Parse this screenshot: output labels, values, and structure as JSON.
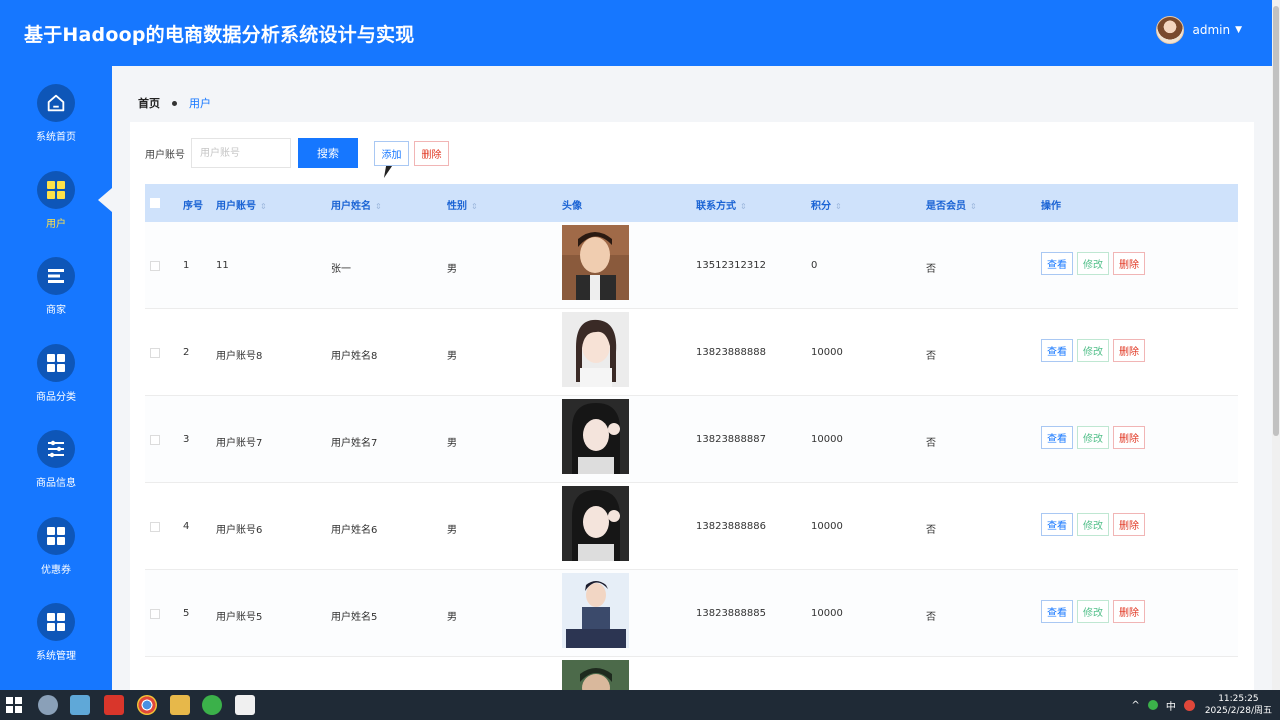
{
  "header": {
    "title": "基于Hadoop的电商数据分析系统设计与实现",
    "username": "admin"
  },
  "sidebar": {
    "items": [
      {
        "label": "系统首页",
        "icon": "home-icon"
      },
      {
        "label": "用户",
        "icon": "grid-icon",
        "active": true
      },
      {
        "label": "商家",
        "icon": "list-icon"
      },
      {
        "label": "商品分类",
        "icon": "grid-icon"
      },
      {
        "label": "商品信息",
        "icon": "sliders-icon"
      },
      {
        "label": "优惠券",
        "icon": "grid-icon"
      },
      {
        "label": "系统管理",
        "icon": "grid-icon"
      }
    ]
  },
  "breadcrumb": {
    "home": "首页",
    "current": "用户"
  },
  "search": {
    "label": "用户账号",
    "placeholder": "用户账号",
    "value": "",
    "button": "搜索",
    "add": "添加",
    "delete": "删除"
  },
  "table": {
    "headers": [
      "序号",
      "用户账号",
      "用户姓名",
      "性别",
      "头像",
      "联系方式",
      "积分",
      "是否会员",
      "操作"
    ],
    "actions": {
      "view": "查看",
      "edit": "修改",
      "delete": "删除"
    },
    "rows": [
      {
        "no": "1",
        "account": "11",
        "name": "张一",
        "gender": "男",
        "phone": "13512312312",
        "points": "0",
        "member": "否"
      },
      {
        "no": "2",
        "account": "用户账号8",
        "name": "用户姓名8",
        "gender": "男",
        "phone": "13823888888",
        "points": "10000",
        "member": "否"
      },
      {
        "no": "3",
        "account": "用户账号7",
        "name": "用户姓名7",
        "gender": "男",
        "phone": "13823888887",
        "points": "10000",
        "member": "否"
      },
      {
        "no": "4",
        "account": "用户账号6",
        "name": "用户姓名6",
        "gender": "男",
        "phone": "13823888886",
        "points": "10000",
        "member": "否"
      },
      {
        "no": "5",
        "account": "用户账号5",
        "name": "用户姓名5",
        "gender": "男",
        "phone": "13823888885",
        "points": "10000",
        "member": "否"
      }
    ]
  },
  "taskbar": {
    "ime": "中",
    "time": "11:25:25",
    "date": "2025/2/28/周五"
  },
  "colors": {
    "primary": "#1677ff",
    "nav_dark": "#0e56b8",
    "active_label": "#ffe24a",
    "danger": "#e0341f",
    "success": "#54c08b"
  }
}
